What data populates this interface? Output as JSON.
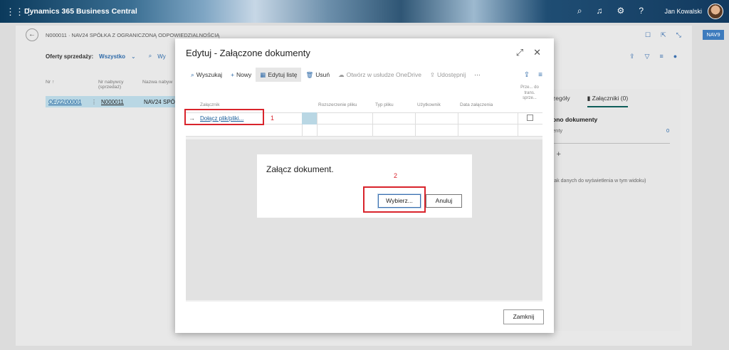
{
  "topbar": {
    "app_name": "Dynamics 365 Business Central",
    "user_name": "Jan Kowalski"
  },
  "page": {
    "breadcrumb": "N000011 · NAV24 SPÓŁKA Z OGRANICZONĄ ODPOWIEDZIALNOŚCIĄ",
    "env_badge": "NAV9",
    "filter_label": "Oferty sprzedaży:",
    "filter_value": "Wszystko",
    "filter_search": "Wy",
    "list_headers": [
      "Nr ↑",
      "Nr nabywcy (sprzedaż)",
      "Nazwa nabyw"
    ],
    "list_row": {
      "no": "OF/22/00001",
      "customer_no": "N000011",
      "name": "NAV24 SPÓ"
    }
  },
  "factbox": {
    "tab_details": "zegóły",
    "tab_attachments": "Załączniki (0)",
    "section_title": "ono dokumenty",
    "row_label": "enty",
    "row_value": "0",
    "plus_label": "i +",
    "empty_text": "rak danych do wyświetlenia w tym widoku)"
  },
  "dialog": {
    "title": "Edytuj - Załączone dokumenty",
    "toolbar": {
      "search": "Wyszukaj",
      "new": "Nowy",
      "edit_list": "Edytuj listę",
      "delete": "Usuń",
      "open_onedrive": "Otwórz w usłudze OneDrive",
      "share": "Udostępnij",
      "more": "···"
    },
    "columns": {
      "attachment": "Załącznik",
      "extension": "Rozszerzenie pliku",
      "file_type": "Typ pliku",
      "user": "Użytkownik",
      "attached_date": "Data załączenia",
      "flow": "Prze... do trans. sprze..."
    },
    "attach_link": "Dołącz plik/pliki...",
    "close_button": "Zamknij"
  },
  "upload_dialog": {
    "title": "Załącz dokument.",
    "choose_button": "Wybierz...",
    "cancel_button": "Anuluj"
  },
  "annotations": {
    "step1": "1",
    "step2": "2",
    "color": "#d9242c"
  }
}
